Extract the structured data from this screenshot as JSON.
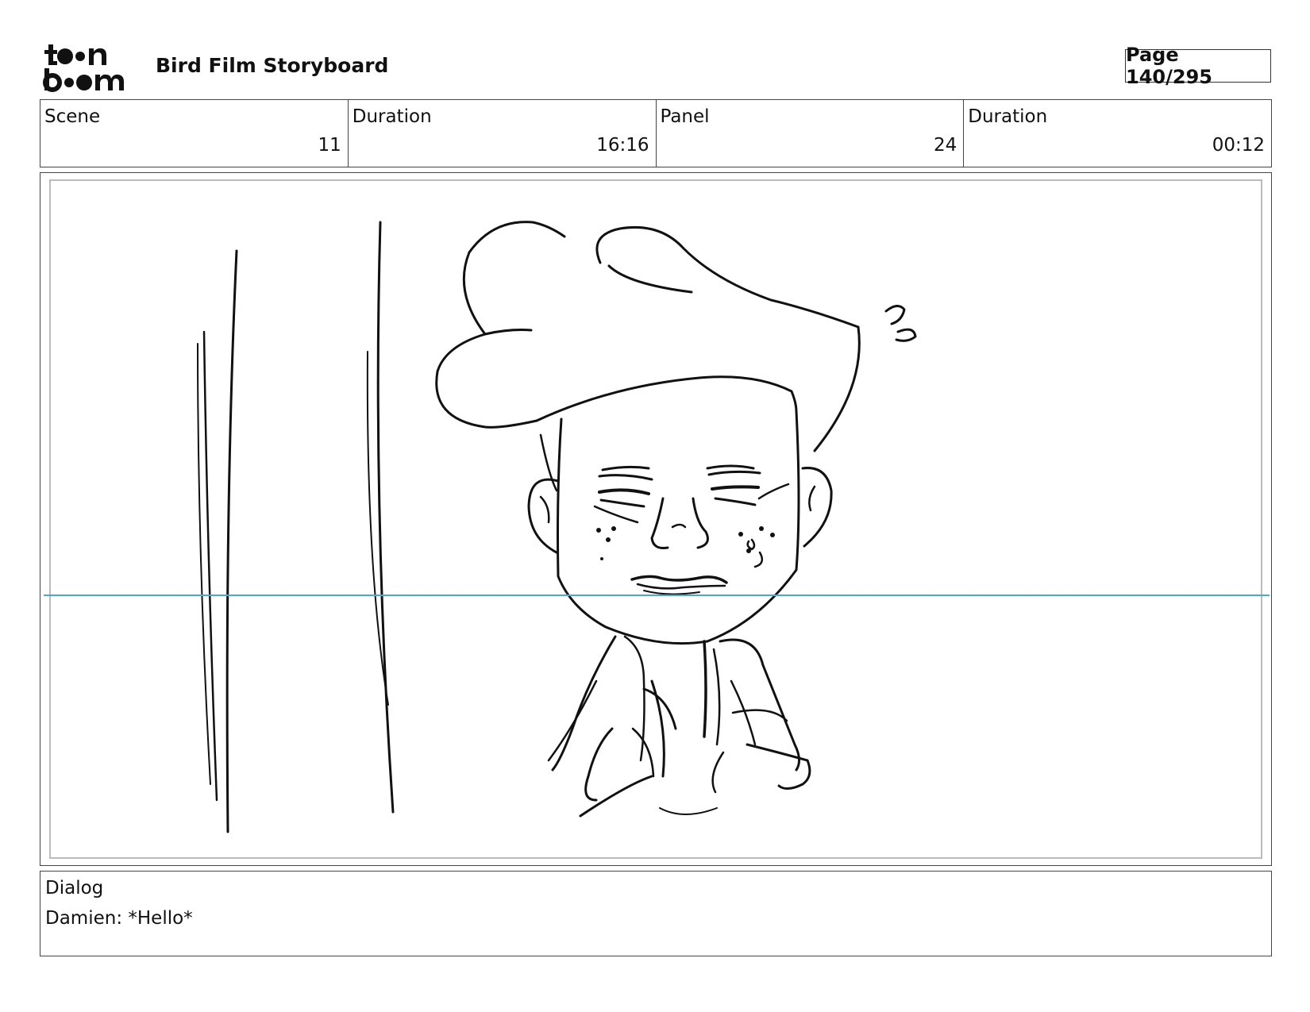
{
  "header": {
    "logo_icon": "toonboom-logo",
    "document_title": "Bird Film Storyboard",
    "page_label": "Page 140/295"
  },
  "info": {
    "scene_label": "Scene",
    "scene_value": "11",
    "scene_duration_label": "Duration",
    "scene_duration_value": "16:16",
    "panel_label": "Panel",
    "panel_value": "24",
    "panel_duration_label": "Duration",
    "panel_duration_value": "00:12"
  },
  "panel": {
    "image_icon": "character-sketch",
    "guide_color": "#4aa8d8"
  },
  "dialog": {
    "label": "Dialog",
    "text": "Damien: *Hello*"
  }
}
